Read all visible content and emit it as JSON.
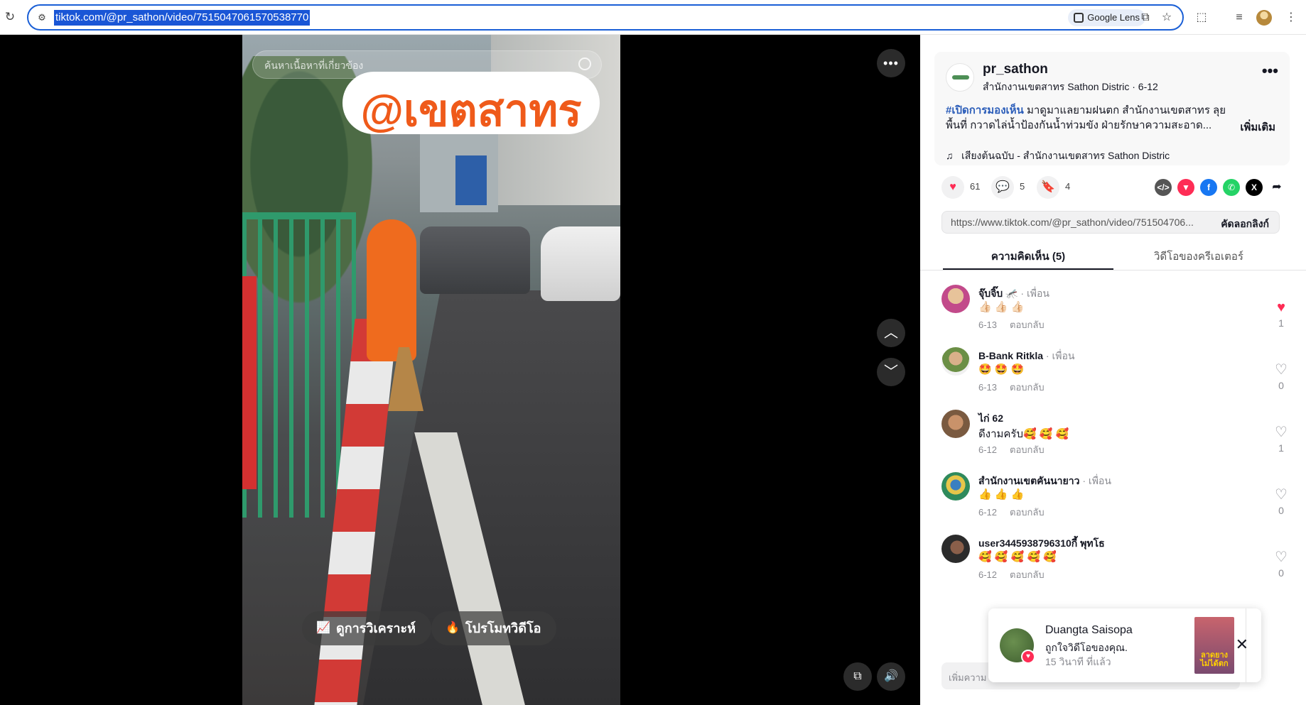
{
  "browser": {
    "url": "tiktok.com/@pr_sathon/video/7515047061570538770",
    "lens_label": "Google Lens"
  },
  "video": {
    "search_placeholder": "ค้นหาเนื้อหาที่เกี่ยวข้อง",
    "overlay_text": "@เขตสาทร",
    "analytics_label": "ดูการวิเคราะห์",
    "promote_label": "โปรโมทวิดีโอ"
  },
  "post": {
    "author_name": "pr_sathon",
    "author_sub": "สำนักงานเขตสาทร Sathon Distric · 6-12",
    "hashtag": "#เปิดการมองเห็น",
    "description": " มาดูมาแลยามฝนตก สำนักงานเขตสาทร ลุยพื้นที่ กวาดไล่น้ำป้องกันน้ำท่วมขัง ฝ่ายรักษาความสะอาด...",
    "more_label": "เพิ่มเติม",
    "music": "เสียงต้นฉบับ - สำนักงานเขตสาทร Sathon Distric",
    "likes": "61",
    "comments": "5",
    "saves": "4",
    "link": "https://www.tiktok.com/@pr_sathon/video/751504706...",
    "copy_label": "คัดลอกลิงก์"
  },
  "tabs": [
    {
      "label": "ความคิดเห็น (5)"
    },
    {
      "label": "วิดีโอของครีเอเตอร์"
    }
  ],
  "comments": [
    {
      "name": "จุ๊บจิ๊บ 🦟",
      "friend": " · เพื่อน",
      "text": "👍🏻 👍🏻 👍🏻",
      "date": "6-13",
      "reply": "ตอบกลับ",
      "likes": "1",
      "liked": true
    },
    {
      "name": "B-Bank Ritkla",
      "friend": " · เพื่อน",
      "text": "🤩 🤩 🤩",
      "date": "6-13",
      "reply": "ตอบกลับ",
      "likes": "0",
      "liked": false
    },
    {
      "name": "ไก่ 62",
      "friend": "",
      "text": "ดีงามครับ🥰 🥰 🥰",
      "date": "6-12",
      "reply": "ตอบกลับ",
      "likes": "1",
      "liked": false
    },
    {
      "name": "สำนักงานเขตคันนายาว",
      "friend": " · เพื่อน",
      "text": "👍 👍 👍",
      "date": "6-12",
      "reply": "ตอบกลับ",
      "likes": "0",
      "liked": false
    },
    {
      "name": "user3445938796310กี้ พุทโธ",
      "friend": "",
      "text": "🥰 🥰 🥰 🥰 🥰",
      "date": "6-12",
      "reply": "ตอบกลับ",
      "likes": "0",
      "liked": false
    }
  ],
  "comment_input_placeholder": "เพิ่มความ",
  "notification": {
    "name": "Duangta Saisopa",
    "text": "ถูกใจวิดีโอของคุณ.",
    "time": "15 วินาที ที่แล้ว",
    "thumb_text": "ลาดยาง ไม่ได้ตก"
  }
}
